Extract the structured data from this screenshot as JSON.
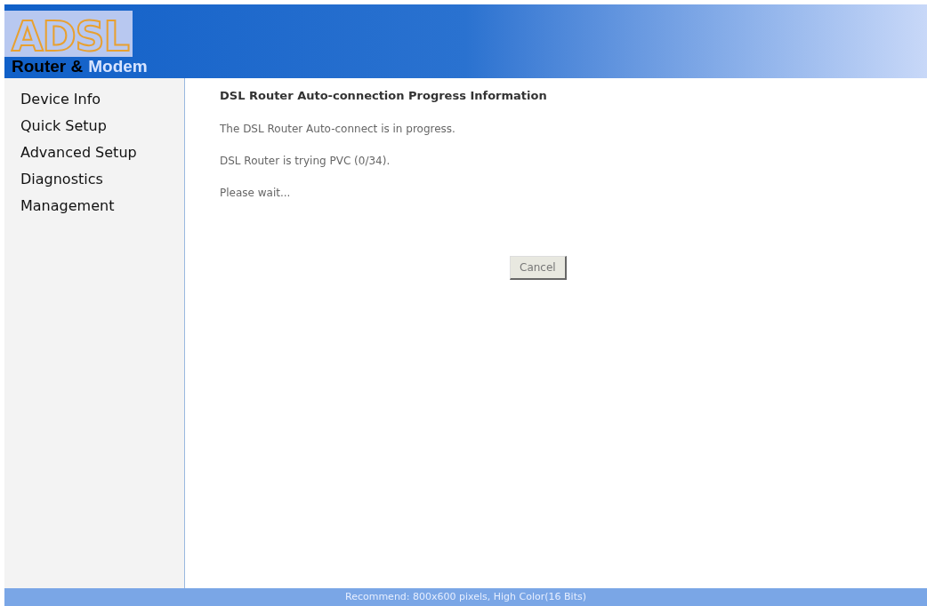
{
  "logo": {
    "mark": "ADSL",
    "title_dark": "Router &",
    "title_light": "Modem"
  },
  "sidebar": {
    "items": [
      {
        "label": "Device Info"
      },
      {
        "label": "Quick Setup"
      },
      {
        "label": "Advanced Setup"
      },
      {
        "label": "Diagnostics"
      },
      {
        "label": "Management"
      }
    ]
  },
  "content": {
    "heading": "DSL Router Auto-connection Progress Information",
    "lines": [
      "The DSL Router Auto-connect is in progress.",
      "DSL Router is trying PVC (0/34).",
      "Please wait..."
    ],
    "button": "Cancel"
  },
  "status_bar": "Recommend: 800x600 pixels, High Color(16 Bits)"
}
